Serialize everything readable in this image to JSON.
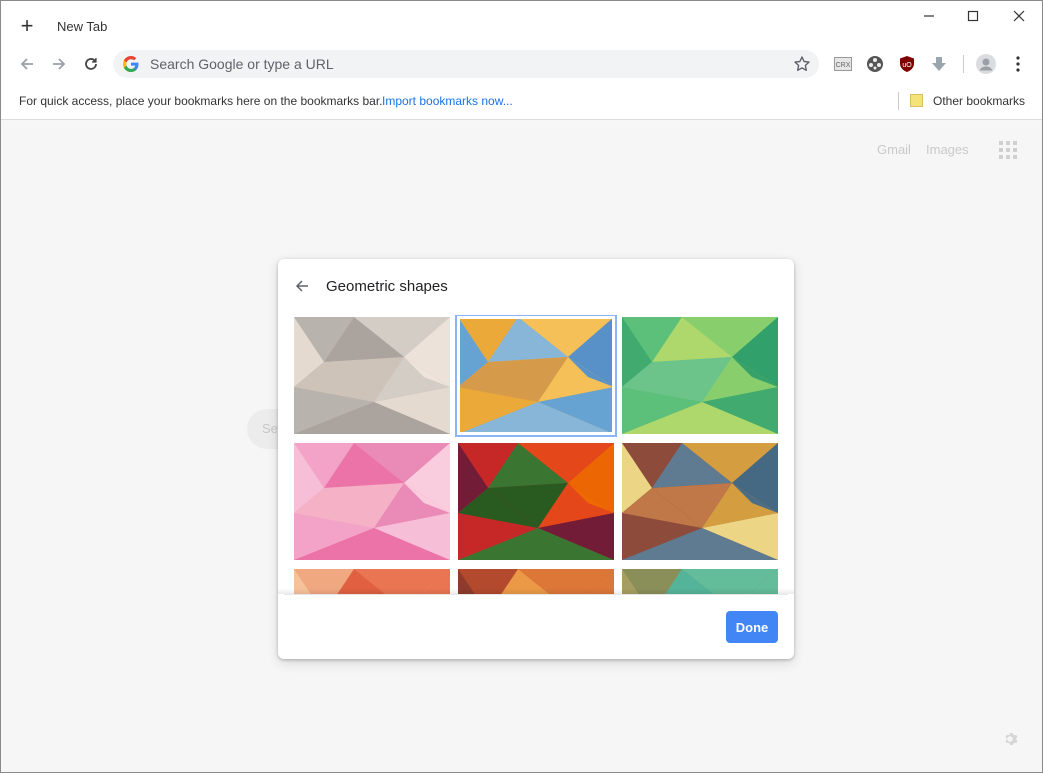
{
  "window": {
    "tab_title": "New Tab",
    "controls": [
      "minimize-icon",
      "maximize-icon",
      "close-icon"
    ]
  },
  "toolbar": {
    "search_placeholder": "Search Google or type a URL",
    "extensions": [
      "crx-extension-icon",
      "film-reel-extension-icon",
      "ublock-origin-icon",
      "download-arrow-icon",
      "profile-avatar-icon",
      "menu-kebab-icon"
    ]
  },
  "bookmarks_bar": {
    "hint": "For quick access, place your bookmarks here on the bookmarks bar.",
    "import_link": "Import bookmarks now...",
    "other_bookmarks": "Other bookmarks"
  },
  "page": {
    "gmail_link": "Gmail",
    "images_link": "Images",
    "search_ghost": "Se"
  },
  "dialog": {
    "title": "Geometric shapes",
    "done_label": "Done",
    "selected_tile": 2,
    "tiles": [
      {
        "name": "gray-beige-polygons",
        "colors": [
          "#b8b3ad",
          "#d6cfc8",
          "#e8ddd2",
          "#a9a39c",
          "#cfc4b8",
          "#f0e6dc"
        ]
      },
      {
        "name": "orange-blue-polygons",
        "colors": [
          "#e9a93a",
          "#f4c25a",
          "#5aa3e0",
          "#7fb7e6",
          "#d29a4c",
          "#4b8fd4"
        ]
      },
      {
        "name": "green-polygons",
        "colors": [
          "#5cbf7a",
          "#8ccf6a",
          "#3fa86e",
          "#b5d96a",
          "#6fc48c",
          "#2f9d68"
        ]
      },
      {
        "name": "pink-polygons",
        "colors": [
          "#f2a3c7",
          "#e889b4",
          "#f7c0d8",
          "#ea6fa4",
          "#f5b2c4",
          "#fbd0e0"
        ]
      },
      {
        "name": "red-green-dark-polygons",
        "colors": [
          "#c62828",
          "#e64a19",
          "#6a1b3a",
          "#2e7d32",
          "#1b5e20",
          "#ef6c00"
        ]
      },
      {
        "name": "yellow-brown-blue-polygons",
        "colors": [
          "#8d4b3c",
          "#d9a441",
          "#f4e28c",
          "#5a7f9a",
          "#c47c4a",
          "#3f6a8a"
        ]
      },
      {
        "name": "peach-orange-polygons",
        "colors": [
          "#f0a880",
          "#e8714f",
          "#f6c49c",
          "#de5a3c"
        ]
      },
      {
        "name": "rust-orange-polygons",
        "colors": [
          "#b34a2e",
          "#e07b39",
          "#8a3b2c",
          "#f0a049"
        ]
      },
      {
        "name": "teal-olive-polygons",
        "colors": [
          "#8a8f5a",
          "#5fc0a0",
          "#a8a062",
          "#4fb79e"
        ]
      }
    ]
  }
}
